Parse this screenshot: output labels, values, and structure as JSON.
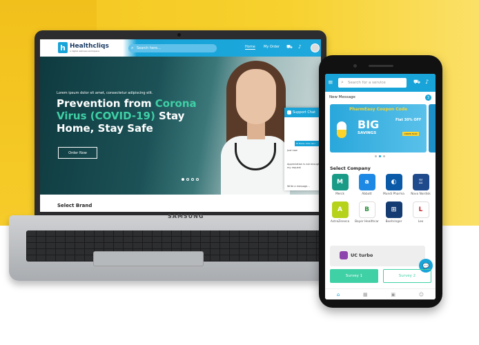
{
  "laptop": {
    "logo_text": "Healthcliqs",
    "logo_tagline": "a digital wellness workspace",
    "search_placeholder": "Search here...",
    "nav": {
      "home": "Home",
      "my_order": "My Order"
    },
    "hero": {
      "subtitle": "Lorem ipsum dolor sit amet, consectetur adipiscing elit.",
      "title_part1": "Prevention from ",
      "title_highlight1": "Corona",
      "title_highlight2": "Virus (COVID-19)",
      "title_part2": " Stay Home, Stay Safe",
      "button": "Order Now"
    },
    "chat": {
      "title": "Support Chat",
      "bubble": "Hi there, how can I",
      "line1": "Just now",
      "line2": "Appreciation is not enough",
      "line3": "my request",
      "input": "Write a message..."
    },
    "section_title": "Select Brand",
    "brand_mark": "SAMSUNG"
  },
  "phone": {
    "search_placeholder": "Search for a service",
    "new_message": "New Message",
    "badge": "3",
    "promo": {
      "title": "PharmEasy Coupon Code",
      "big": "BIG",
      "savings": "SAVINGS",
      "flat": "Flat 30% OFF",
      "button": "ORDER NOW"
    },
    "select_company": "Select Company",
    "companies": [
      {
        "name": "Merck",
        "color": "#1a9b88",
        "glyph": "M"
      },
      {
        "name": "Abbott",
        "color": "#1e88e5",
        "glyph": "a"
      },
      {
        "name": "Mundi Pharma",
        "color": "#0a5aa8",
        "glyph": "◐"
      },
      {
        "name": "Novo Nordisk",
        "color": "#1f4a8c",
        "glyph": "♖"
      },
      {
        "name": "AstraZeneca",
        "color": "#b7d21b",
        "glyph": "A"
      },
      {
        "name": "Bayer Healthcar",
        "color": "#ffffff",
        "glyph": "B"
      },
      {
        "name": "Boehringer",
        "color": "#143c73",
        "glyph": "⊞"
      },
      {
        "name": "Leo",
        "color": "#ffffff",
        "glyph": "L"
      }
    ],
    "uc_text": "UC turbo",
    "survey1": "Survey 1",
    "survey2": "Survey 2"
  }
}
